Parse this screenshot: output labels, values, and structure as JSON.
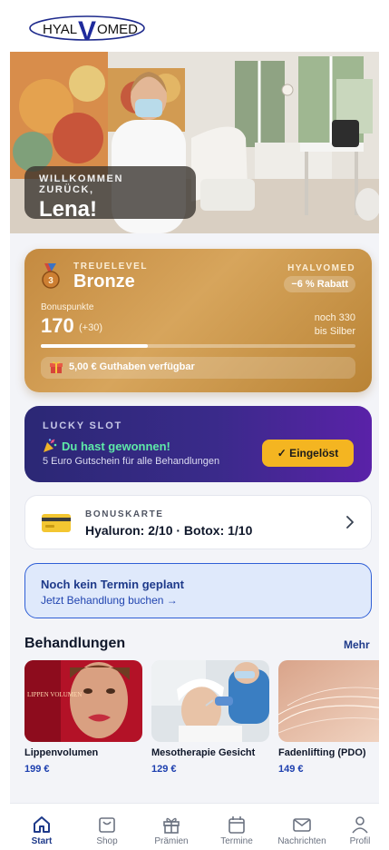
{
  "header": {
    "logo_left": "HYAL",
    "logo_mid": "V",
    "logo_right": "OMED"
  },
  "hero": {
    "kicker": "WILLKOMMEN ZURÜCK,",
    "name": "Lena!"
  },
  "loyalty": {
    "kicker": "TREUELEVEL",
    "level": "Bronze",
    "brand": "HYALVOMED",
    "discount": "−6 % Rabatt",
    "points_label": "Bonuspunkte",
    "points": "170",
    "points_delta": "(+30)",
    "next_line1": "noch 330",
    "next_line2": "bis Silber",
    "progress_fraction": 0.34,
    "credit": "5,00 € Guthaben verfügbar",
    "medal_icon": "bronze-medal-icon",
    "gift_icon": "gift-icon"
  },
  "lucky": {
    "kicker": "LUCKY SLOT",
    "won": "Du hast gewonnen!",
    "desc": "5 Euro Gutschein für alle Behandlungen",
    "button": "✓ Eingelöst",
    "icon": "party-popper-icon"
  },
  "bonus_card": {
    "kicker": "BONUSKARTE",
    "value": "Hyaluron: 2/10 · Botox: 1/10",
    "icon": "credit-card-icon"
  },
  "appointment": {
    "title": "Noch kein Termin geplant",
    "link": "Jetzt Behandlung buchen →"
  },
  "treatments": {
    "title": "Behandlungen",
    "more": "Mehr",
    "items": [
      {
        "name": "Lippenvolumen",
        "price": "199 €",
        "image_text": "LIPPEN VOLUMEN"
      },
      {
        "name": "Mesotherapie Gesicht",
        "price": "129 €"
      },
      {
        "name": "Fadenlifting (PDO)",
        "price": "149 €"
      }
    ]
  },
  "nav": {
    "items": [
      {
        "label": "Start",
        "icon": "home-icon",
        "active": true
      },
      {
        "label": "Shop",
        "icon": "shopping-bag-icon"
      },
      {
        "label": "Prämien",
        "icon": "gift-icon"
      },
      {
        "label": "Termine",
        "icon": "calendar-icon"
      },
      {
        "label": "Nachrichten",
        "icon": "mail-icon"
      },
      {
        "label": "Profil",
        "icon": "user-icon"
      }
    ]
  },
  "colors": {
    "brand_blue": "#1e3a8a",
    "bronze": "#c48a40",
    "lucky_bg": "#2b2875",
    "win_green": "#5ee9a8",
    "redeem": "#f4b521"
  }
}
